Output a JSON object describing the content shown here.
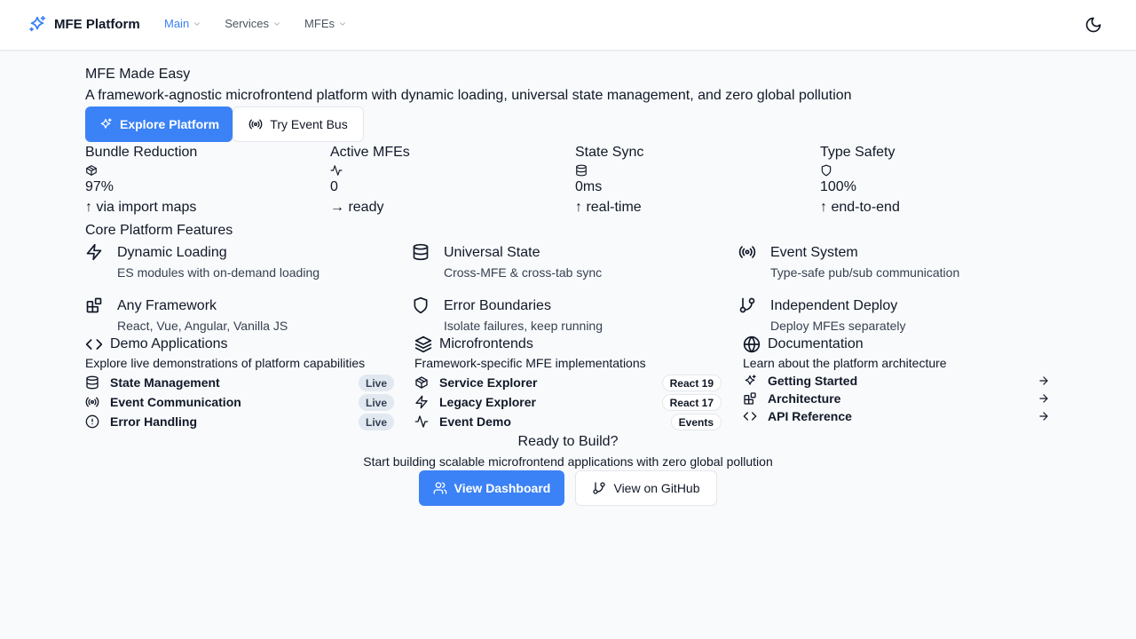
{
  "header": {
    "brand": "MFE Platform",
    "nav": [
      {
        "label": "Main",
        "active": true
      },
      {
        "label": "Services",
        "active": false
      },
      {
        "label": "MFEs",
        "active": false
      }
    ],
    "theme_toggle_icon": "moon-icon"
  },
  "hero": {
    "title": "MFE Made Easy",
    "subtitle": "A framework-agnostic microfrontend platform with dynamic loading, universal state management, and zero global pollution",
    "primary_button": "Explore Platform",
    "secondary_button": "Try Event Bus"
  },
  "stats": [
    {
      "label": "Bundle Reduction",
      "icon": "package-icon",
      "value": "97%",
      "trend": "↑ via import maps"
    },
    {
      "label": "Active MFEs",
      "icon": "activity-icon",
      "value": "0",
      "trend": "→ ready"
    },
    {
      "label": "State Sync",
      "icon": "database-icon",
      "value": "0ms",
      "trend": "↑ real-time"
    },
    {
      "label": "Type Safety",
      "icon": "shield-icon",
      "value": "100%",
      "trend": "↑ end-to-end"
    }
  ],
  "features": {
    "title": "Core Platform Features",
    "items": [
      {
        "title": "Dynamic Loading",
        "desc": "ES modules with on-demand loading",
        "icon": "zap-icon"
      },
      {
        "title": "Universal State",
        "desc": "Cross-MFE & cross-tab sync",
        "icon": "database-icon"
      },
      {
        "title": "Event System",
        "desc": "Type-safe pub/sub communication",
        "icon": "radio-icon"
      },
      {
        "title": "Any Framework",
        "desc": "React, Vue, Angular, Vanilla JS",
        "icon": "blocks-icon"
      },
      {
        "title": "Error Boundaries",
        "desc": "Isolate failures, keep running",
        "icon": "shield-icon"
      },
      {
        "title": "Independent Deploy",
        "desc": "Deploy MFEs separately",
        "icon": "git-branch-icon"
      }
    ]
  },
  "demo": {
    "title": "Demo Applications",
    "desc": "Explore live demonstrations of platform capabilities",
    "items": [
      {
        "label": "State Management",
        "badge": "Live",
        "icon": "database-icon"
      },
      {
        "label": "Event Communication",
        "badge": "Live",
        "icon": "radio-icon"
      },
      {
        "label": "Error Handling",
        "badge": "Live",
        "icon": "alert-circle-icon"
      }
    ]
  },
  "microfrontends": {
    "title": "Microfrontends",
    "desc": "Framework-specific MFE implementations",
    "items": [
      {
        "label": "Service Explorer",
        "badge": "React 19",
        "icon": "package-icon"
      },
      {
        "label": "Legacy Explorer",
        "badge": "React 17",
        "icon": "zap-icon"
      },
      {
        "label": "Event Demo",
        "badge": "Events",
        "icon": "activity-icon"
      }
    ]
  },
  "docs": {
    "title": "Documentation",
    "desc": "Learn about the platform architecture",
    "items": [
      {
        "label": "Getting Started",
        "icon": "sparkles-icon"
      },
      {
        "label": "Architecture",
        "icon": "blocks-icon"
      },
      {
        "label": "API Reference",
        "icon": "code-icon"
      }
    ]
  },
  "cta": {
    "title": "Ready to Build?",
    "subtitle": "Start building scalable microfrontend applications with zero global pollution",
    "primary_button": "View Dashboard",
    "secondary_button": "View on GitHub"
  },
  "colors": {
    "accent": "#3b82f6",
    "background": "#f8fafc",
    "badge_grey": "#e2e8f0"
  }
}
